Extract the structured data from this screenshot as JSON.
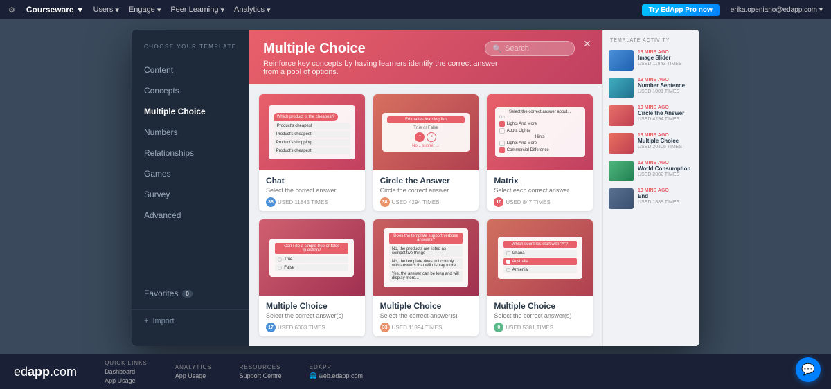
{
  "nav": {
    "gear_label": "⚙",
    "app_name": "Courseware",
    "items": [
      {
        "label": "Users",
        "arrow": "▾"
      },
      {
        "label": "Engage",
        "arrow": "▾"
      },
      {
        "label": "Peer Learning",
        "arrow": "▾"
      },
      {
        "label": "Analytics",
        "arrow": "▾"
      }
    ],
    "cta_label": "Try EdApp Pro now",
    "user_email": "erika.openiano@edapp.com",
    "user_arrow": "▾"
  },
  "sidebar": {
    "section_title": "Choose Your Template",
    "items": [
      {
        "label": "Content",
        "active": false
      },
      {
        "label": "Concepts",
        "active": false
      },
      {
        "label": "Multiple Choice",
        "active": true
      },
      {
        "label": "Numbers",
        "active": false
      },
      {
        "label": "Relationships",
        "active": false
      },
      {
        "label": "Games",
        "active": false
      },
      {
        "label": "Survey",
        "active": false
      },
      {
        "label": "Advanced",
        "active": false
      }
    ],
    "favorites_label": "Favorites",
    "favorites_count": "0",
    "import_label": "Import",
    "import_icon": "+"
  },
  "modal": {
    "title": "Multiple Choice",
    "subtitle": "Reinforce key concepts by having learners identify the correct answer from a pool of options.",
    "search_placeholder": "Search",
    "close_icon": "✕"
  },
  "templates": [
    {
      "name": "Chat",
      "description": "Select the correct answer",
      "stat1_color": "blue",
      "stat1_value": "38",
      "stat1_label": "USED 11845 TIMES",
      "type": "chat"
    },
    {
      "name": "Circle the Answer",
      "description": "Circle the correct answer",
      "stat1_color": "orange",
      "stat1_value": "38",
      "stat1_label": "USED 4294 TIMES",
      "type": "circle"
    },
    {
      "name": "Matrix",
      "description": "Select each correct answer",
      "stat1_color": "red",
      "stat1_value": "10",
      "stat1_label": "USED 847 TIMES",
      "type": "matrix"
    },
    {
      "name": "Multiple Choice",
      "description": "Select the correct answer(s)",
      "stat1_color": "blue",
      "stat1_value": "17",
      "stat1_label": "USED 6003 TIMES",
      "type": "truefalse"
    },
    {
      "name": "Multiple Choice",
      "description": "Select the correct answer(s)",
      "stat1_color": "orange",
      "stat1_value": "33",
      "stat1_label": "USED 11894 TIMES",
      "type": "support"
    },
    {
      "name": "Multiple Choice",
      "description": "Select the correct answer(s)",
      "stat1_color": "green",
      "stat1_value": "0",
      "stat1_label": "USED 5381 TIMES",
      "type": "countries"
    }
  ],
  "activity": {
    "title": "Template Activity",
    "items": [
      {
        "thumb_color": "blue",
        "time": "13 MINS AGO",
        "name": "Image Slider",
        "used": "USED 11843 TIMES"
      },
      {
        "thumb_color": "teal",
        "time": "13 MINS AGO",
        "name": "Number Sentence",
        "used": "USED 1001 TIMES"
      },
      {
        "thumb_color": "salmon",
        "time": "13 MINS AGO",
        "name": "Circle the Answer",
        "used": "USED 4294 TIMES"
      },
      {
        "thumb_color": "coral",
        "time": "13 MINS AGO",
        "name": "Multiple Choice",
        "used": "USED 20406 TIMES"
      },
      {
        "thumb_color": "green",
        "time": "13 MINS AGO",
        "name": "World Consumption",
        "used": "USED 2882 TIMES"
      },
      {
        "thumb_color": "steel",
        "time": "13 MINS AGO",
        "name": "End",
        "used": "USED 1889 TIMES"
      }
    ]
  },
  "footer": {
    "brand": "edapp.com",
    "sections": [
      {
        "title": "Quick Links",
        "links": [
          "Dashboard",
          "App Usage"
        ]
      },
      {
        "title": "Analytics",
        "links": [
          "App Usage"
        ]
      },
      {
        "title": "Resources",
        "links": [
          "Support Centre"
        ]
      },
      {
        "title": "EdApp",
        "links": [
          "web.edapp.com"
        ]
      }
    ]
  }
}
